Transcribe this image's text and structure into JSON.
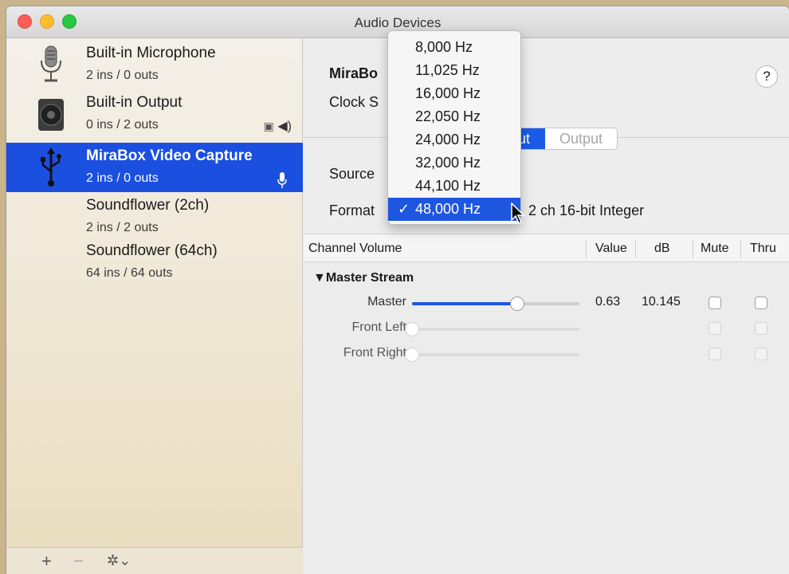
{
  "window": {
    "title": "Audio Devices"
  },
  "sidebar": {
    "devices": [
      {
        "name": "Built-in Microphone",
        "io": "2 ins / 0 outs",
        "icon": "microphone-icon"
      },
      {
        "name": "Built-in Output",
        "io": "0 ins / 2 outs",
        "icon": "speaker-icon"
      },
      {
        "name": "MiraBox Video Capture",
        "io": "2 ins / 0 outs",
        "icon": "usb-icon",
        "selected": true
      },
      {
        "name": "Soundflower (2ch)",
        "io": "2 ins / 2 outs"
      },
      {
        "name": "Soundflower (64ch)",
        "io": "64 ins / 64 outs"
      }
    ],
    "footer": {
      "add": "+",
      "remove": "−",
      "gear": "✲⌄"
    }
  },
  "device_panel": {
    "title": "MiraBo",
    "clock_label": "Clock S",
    "help": "?",
    "tabs": {
      "input": "ut",
      "output": "Output"
    },
    "source_label": "Source",
    "format_label": "Format",
    "format_value": "2 ch 16-bit Integer"
  },
  "rate_menu": {
    "items": [
      "8,000 Hz",
      "11,025 Hz",
      "16,000 Hz",
      "22,050 Hz",
      "24,000 Hz",
      "32,000 Hz",
      "44,100 Hz",
      "48,000 Hz"
    ],
    "selected": "48,000 Hz",
    "check": "✓"
  },
  "table": {
    "headers": {
      "channel": "Channel Volume",
      "value": "Value",
      "db": "dB",
      "mute": "Mute",
      "thru": "Thru"
    },
    "group": "▼Master Stream",
    "rows": [
      {
        "label": "Master",
        "value": "0.63",
        "db": "10.145",
        "level": 0.63,
        "enabled": true
      },
      {
        "label": "Front Left",
        "value": "",
        "db": "",
        "level": 0,
        "enabled": false
      },
      {
        "label": "Front Right",
        "value": "",
        "db": "",
        "level": 0,
        "enabled": false
      }
    ]
  },
  "colors": {
    "selection": "#1a4fe0",
    "accent": "#1f56e0"
  }
}
